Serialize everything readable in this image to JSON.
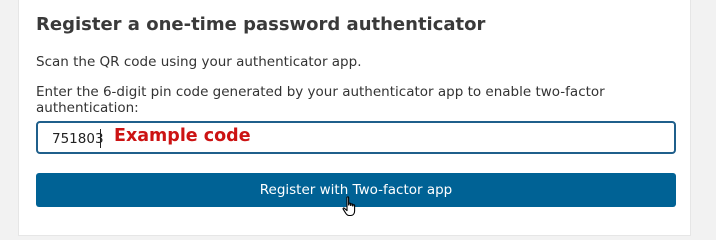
{
  "panel": {
    "title": "Register a one-time password authenticator",
    "instruction": "Scan the QR code using your authenticator app.",
    "pin_label": "Enter the 6-digit pin code generated by your authenticator app to enable two-factor authentication:"
  },
  "pin_input": {
    "value": "751803",
    "annotation": "Example code"
  },
  "register_button": {
    "label": "Register with Two-factor app"
  },
  "colors": {
    "button_bg": "#006295",
    "input_border": "#1f5f8b",
    "annotation": "#cc1313"
  },
  "icons": {
    "cursor": "hand-pointer-icon"
  }
}
